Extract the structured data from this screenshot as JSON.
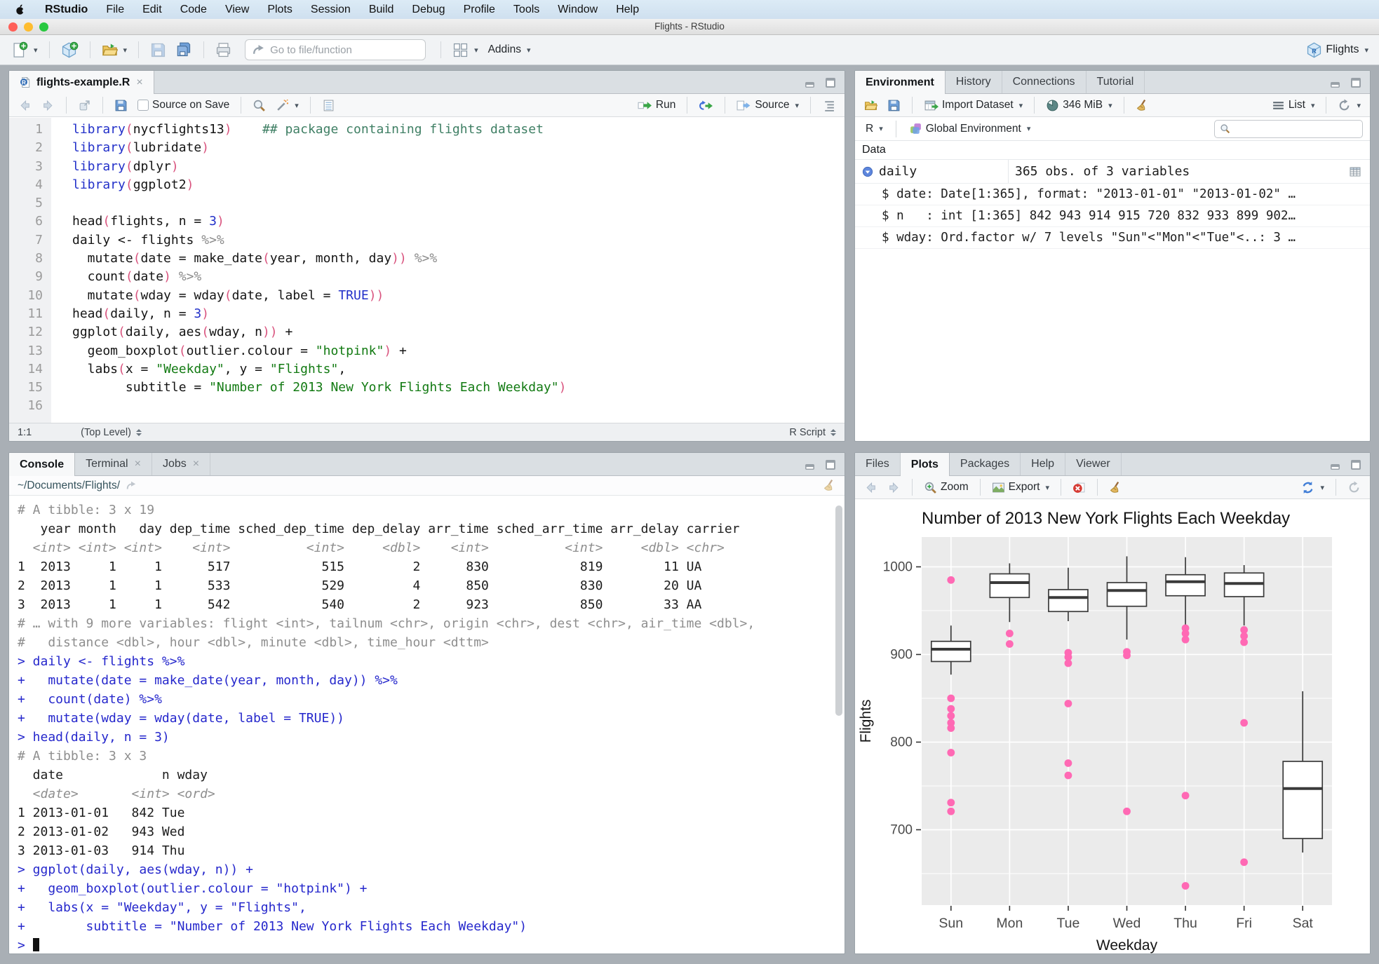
{
  "menu_bar": {
    "items": [
      "RStudio",
      "File",
      "Edit",
      "Code",
      "View",
      "Plots",
      "Session",
      "Build",
      "Debug",
      "Profile",
      "Tools",
      "Window",
      "Help"
    ]
  },
  "title_bar": {
    "title": "Flights - RStudio",
    "traffic_lights": [
      "#ff5f57",
      "#febc2e",
      "#28c840"
    ]
  },
  "toolbar": {
    "goto_placeholder": "Go to file/function",
    "addins_label": "Addins",
    "project_label": "Flights"
  },
  "source_pane": {
    "tab": "flights-example.R",
    "source_on_save": "Source on Save",
    "run_label": "Run",
    "source_label": "Source",
    "status": {
      "cursor": "1:1",
      "scope": "(Top Level)",
      "type": "R Script"
    },
    "code_lines": [
      [
        [
          "fn",
          "library"
        ],
        [
          "pa",
          "("
        ],
        [
          "tx",
          "nycflights13"
        ],
        [
          "pa",
          ")"
        ],
        [
          "tx",
          "    "
        ],
        [
          "cm",
          "## package containing flights dataset"
        ]
      ],
      [
        [
          "fn",
          "library"
        ],
        [
          "pa",
          "("
        ],
        [
          "tx",
          "lubridate"
        ],
        [
          "pa",
          ")"
        ]
      ],
      [
        [
          "fn",
          "library"
        ],
        [
          "pa",
          "("
        ],
        [
          "tx",
          "dplyr"
        ],
        [
          "pa",
          ")"
        ]
      ],
      [
        [
          "fn",
          "library"
        ],
        [
          "pa",
          "("
        ],
        [
          "tx",
          "ggplot2"
        ],
        [
          "pa",
          ")"
        ]
      ],
      [],
      [
        [
          "tx",
          "head"
        ],
        [
          "pa",
          "("
        ],
        [
          "tx",
          "flights, n = "
        ],
        [
          "nu",
          "3"
        ],
        [
          "pa",
          ")"
        ]
      ],
      [
        [
          "tx",
          "daily <- flights "
        ],
        [
          "op",
          "%>%"
        ]
      ],
      [
        [
          "tx",
          "  mutate"
        ],
        [
          "pa",
          "("
        ],
        [
          "tx",
          "date = make_date"
        ],
        [
          "pa",
          "("
        ],
        [
          "tx",
          "year, month, day"
        ],
        [
          "pa",
          "))"
        ],
        [
          "tx",
          " "
        ],
        [
          "op",
          "%>%"
        ]
      ],
      [
        [
          "tx",
          "  count"
        ],
        [
          "pa",
          "("
        ],
        [
          "tx",
          "date"
        ],
        [
          "pa",
          ")"
        ],
        [
          "tx",
          " "
        ],
        [
          "op",
          "%>%"
        ]
      ],
      [
        [
          "tx",
          "  mutate"
        ],
        [
          "pa",
          "("
        ],
        [
          "tx",
          "wday = wday"
        ],
        [
          "pa",
          "("
        ],
        [
          "tx",
          "date, label = "
        ],
        [
          "nu",
          "TRUE"
        ],
        [
          "pa",
          "))"
        ]
      ],
      [
        [
          "tx",
          "head"
        ],
        [
          "pa",
          "("
        ],
        [
          "tx",
          "daily, n = "
        ],
        [
          "nu",
          "3"
        ],
        [
          "pa",
          ")"
        ]
      ],
      [
        [
          "tx",
          "ggplot"
        ],
        [
          "pa",
          "("
        ],
        [
          "tx",
          "daily, aes"
        ],
        [
          "pa",
          "("
        ],
        [
          "tx",
          "wday, n"
        ],
        [
          "pa",
          "))"
        ],
        [
          "tx",
          " +"
        ]
      ],
      [
        [
          "tx",
          "  geom_boxplot"
        ],
        [
          "pa",
          "("
        ],
        [
          "tx",
          "outlier.colour = "
        ],
        [
          "st",
          "\"hotpink\""
        ],
        [
          "pa",
          ")"
        ],
        [
          "tx",
          " +"
        ]
      ],
      [
        [
          "tx",
          "  labs"
        ],
        [
          "pa",
          "("
        ],
        [
          "tx",
          "x = "
        ],
        [
          "st",
          "\"Weekday\""
        ],
        [
          "tx",
          ", y = "
        ],
        [
          "st",
          "\"Flights\""
        ],
        [
          "tx",
          ","
        ]
      ],
      [
        [
          "tx",
          "       subtitle = "
        ],
        [
          "st",
          "\"Number of 2013 New York Flights Each Weekday\""
        ],
        [
          "pa",
          ")"
        ]
      ],
      []
    ]
  },
  "environment_pane": {
    "tabs": [
      "Environment",
      "History",
      "Connections",
      "Tutorial"
    ],
    "active_tab": "Environment",
    "import_label": "Import Dataset",
    "memory_label": "346 MiB",
    "list_label": "List",
    "r_label": "R",
    "env_label": "Global Environment",
    "section_label": "Data",
    "object": {
      "name": "daily",
      "desc": "365 obs. of 3 variables"
    },
    "fields": [
      "$ date: Date[1:365], format: \"2013-01-01\" \"2013-01-02\" …",
      "$ n   : int [1:365] 842 943 914 915 720 832 933 899 902…",
      "$ wday: Ord.factor w/ 7 levels \"Sun\"<\"Mon\"<\"Tue\"<..: 3 …"
    ]
  },
  "console_pane": {
    "tabs": [
      "Console",
      "Terminal",
      "Jobs"
    ],
    "active_tab": "Console",
    "closable_tabs": [
      "Terminal",
      "Jobs"
    ],
    "path": "~/Documents/Flights/",
    "lines": [
      {
        "c": "gray",
        "t": "# A tibble: 3 x 19"
      },
      {
        "c": "black",
        "t": "   year month   day dep_time sched_dep_time dep_delay arr_time sched_arr_time arr_delay carrier"
      },
      {
        "c": "gray",
        "i": true,
        "t": "  <int> <int> <int>    <int>          <int>     <dbl>    <int>          <int>     <dbl> <chr>"
      },
      {
        "c": "black",
        "t": "1  2013     1     1      517            515         2      830            819        11 UA"
      },
      {
        "c": "black",
        "t": "2  2013     1     1      533            529         4      850            830        20 UA"
      },
      {
        "c": "black",
        "t": "3  2013     1     1      542            540         2      923            850        33 AA"
      },
      {
        "c": "gray",
        "t": "# … with 9 more variables: flight <int>, tailnum <chr>, origin <chr>, dest <chr>, air_time <dbl>,"
      },
      {
        "c": "gray",
        "t": "#   distance <dbl>, hour <dbl>, minute <dbl>, time_hour <dttm>"
      },
      {
        "c": "blue",
        "t": "> daily <- flights %>%"
      },
      {
        "c": "blue",
        "t": "+   mutate(date = make_date(year, month, day)) %>%"
      },
      {
        "c": "blue",
        "t": "+   count(date) %>%"
      },
      {
        "c": "blue",
        "t": "+   mutate(wday = wday(date, label = TRUE))"
      },
      {
        "c": "blue",
        "t": "> head(daily, n = 3)"
      },
      {
        "c": "gray",
        "t": "# A tibble: 3 x 3"
      },
      {
        "c": "black",
        "t": "  date             n wday"
      },
      {
        "c": "gray",
        "i": true,
        "t": "  <date>       <int> <ord>"
      },
      {
        "c": "black",
        "t": "1 2013-01-01   842 Tue"
      },
      {
        "c": "black",
        "t": "2 2013-01-02   943 Wed"
      },
      {
        "c": "black",
        "t": "3 2013-01-03   914 Thu"
      },
      {
        "c": "blue",
        "t": "> ggplot(daily, aes(wday, n)) +"
      },
      {
        "c": "blue",
        "t": "+   geom_boxplot(outlier.colour = \"hotpink\") +"
      },
      {
        "c": "blue",
        "t": "+   labs(x = \"Weekday\", y = \"Flights\","
      },
      {
        "c": "blue",
        "t": "+        subtitle = \"Number of 2013 New York Flights Each Weekday\")"
      },
      {
        "c": "blue",
        "t": "> ",
        "cursor": true
      }
    ]
  },
  "plots_pane": {
    "tabs": [
      "Files",
      "Plots",
      "Packages",
      "Help",
      "Viewer"
    ],
    "active_tab": "Plots",
    "zoom_label": "Zoom",
    "export_label": "Export"
  },
  "chart_data": {
    "type": "boxplot",
    "title": "Number of 2013 New York Flights Each Weekday",
    "xlabel": "Weekday",
    "ylabel": "Flights",
    "categories": [
      "Sun",
      "Mon",
      "Tue",
      "Wed",
      "Thu",
      "Fri",
      "Sat"
    ],
    "ylim": [
      614,
      1034
    ],
    "yticks": [
      700,
      800,
      900,
      1000
    ],
    "yticks_minor": [
      650,
      750,
      850,
      950
    ],
    "grid": true,
    "panel_color": "#EBEBEB",
    "outlier_color": "#FF69B4",
    "series": [
      {
        "name": "Sun",
        "lo": 877,
        "q1": 892,
        "median": 906,
        "q3": 915,
        "hi": 933,
        "outliers": [
          985,
          850,
          838,
          830,
          822,
          816,
          788,
          731,
          721
        ]
      },
      {
        "name": "Mon",
        "lo": 937,
        "q1": 965,
        "median": 982,
        "q3": 992,
        "hi": 1004,
        "outliers": [
          924,
          912
        ]
      },
      {
        "name": "Tue",
        "lo": 938,
        "q1": 949,
        "median": 965,
        "q3": 974,
        "hi": 999,
        "outliers": [
          902,
          897,
          890,
          844,
          776,
          762
        ]
      },
      {
        "name": "Wed",
        "lo": 917,
        "q1": 955,
        "median": 973,
        "q3": 982,
        "hi": 1012,
        "outliers": [
          903,
          899,
          721
        ]
      },
      {
        "name": "Thu",
        "lo": 933,
        "q1": 967,
        "median": 983,
        "q3": 991,
        "hi": 1011,
        "outliers": [
          930,
          924,
          917,
          739,
          636
        ]
      },
      {
        "name": "Fri",
        "lo": 933,
        "q1": 966,
        "median": 981,
        "q3": 993,
        "hi": 1002,
        "outliers": [
          928,
          921,
          914,
          822,
          663
        ]
      },
      {
        "name": "Sat",
        "lo": 674,
        "q1": 690,
        "median": 747,
        "q3": 778,
        "hi": 858,
        "outliers": []
      }
    ]
  }
}
